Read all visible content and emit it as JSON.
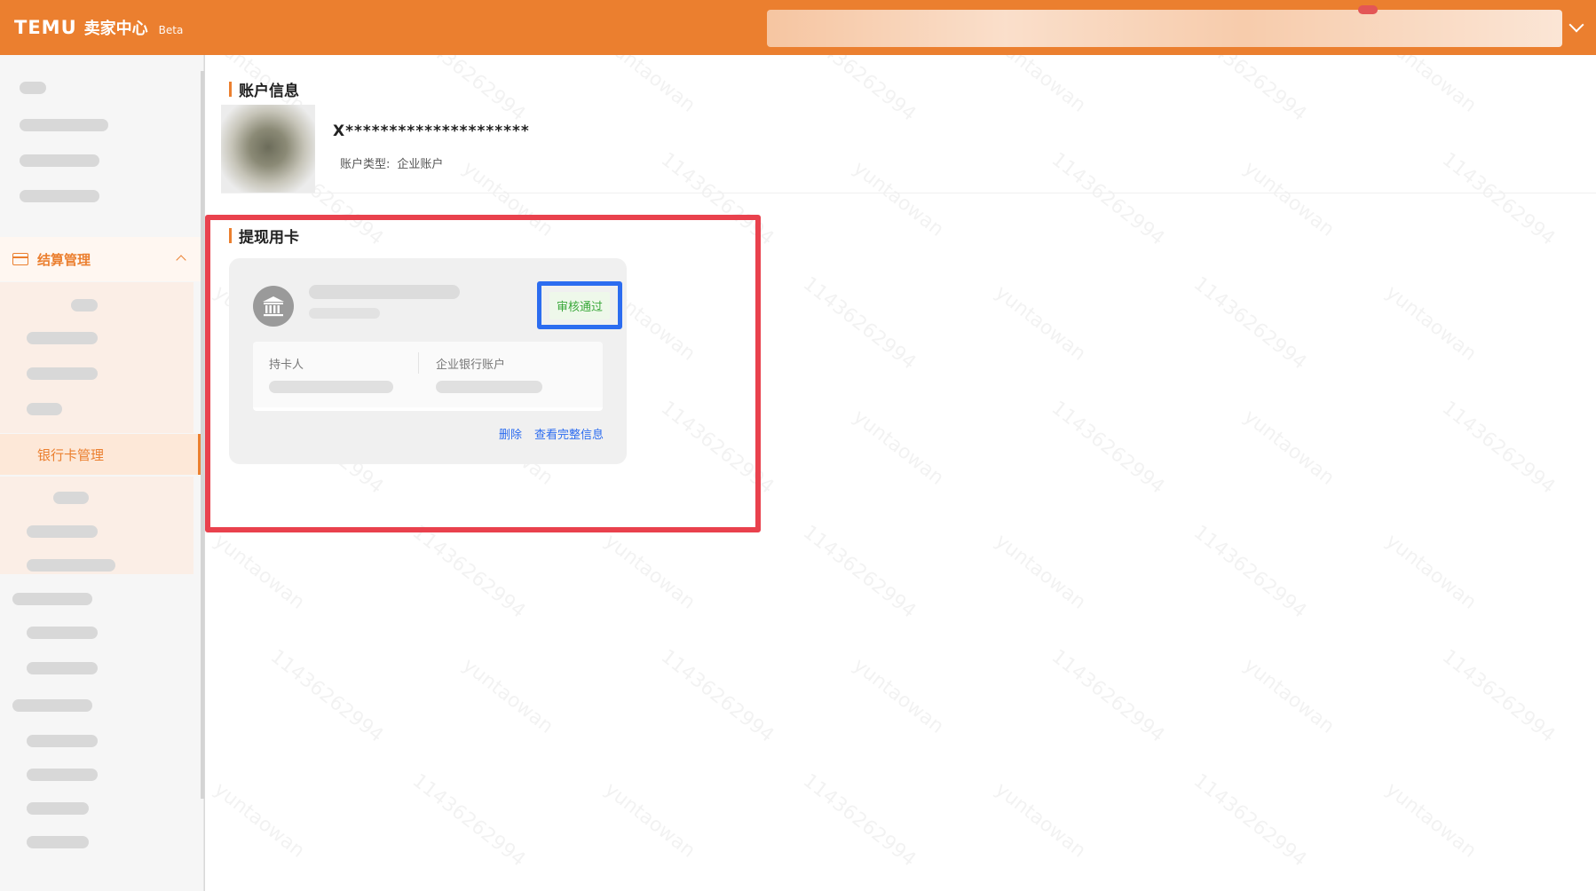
{
  "header": {
    "logo": "TEMU",
    "title": "卖家中心",
    "badge": "Beta",
    "chevron_icon": "chevron-down-icon",
    "brand_color": "#eb7f2f"
  },
  "sidebar": {
    "group": {
      "label": "结算管理",
      "icon": "wallet-icon",
      "expanded": true
    },
    "active_item": {
      "label": "银行卡管理"
    }
  },
  "account": {
    "section_title": "账户信息",
    "name": "X*********************",
    "type_label": "账户类型:",
    "type_value": "企业账户"
  },
  "withdraw": {
    "section_title": "提现用卡",
    "card": {
      "bank_icon": "bank-icon",
      "status": "审核通过",
      "holder_label": "持卡人",
      "account_label": "企业银行账户",
      "delete_label": "删除",
      "view_full_label": "查看完整信息"
    }
  },
  "watermark": {
    "text_a": "yuntaowan",
    "text_b": "11436262994"
  },
  "colors": {
    "accent": "#eb7f2f",
    "link": "#2c6cf0",
    "success": "#3aa83a",
    "highlight_red": "#e9414d",
    "highlight_blue": "#2c6cf0"
  }
}
